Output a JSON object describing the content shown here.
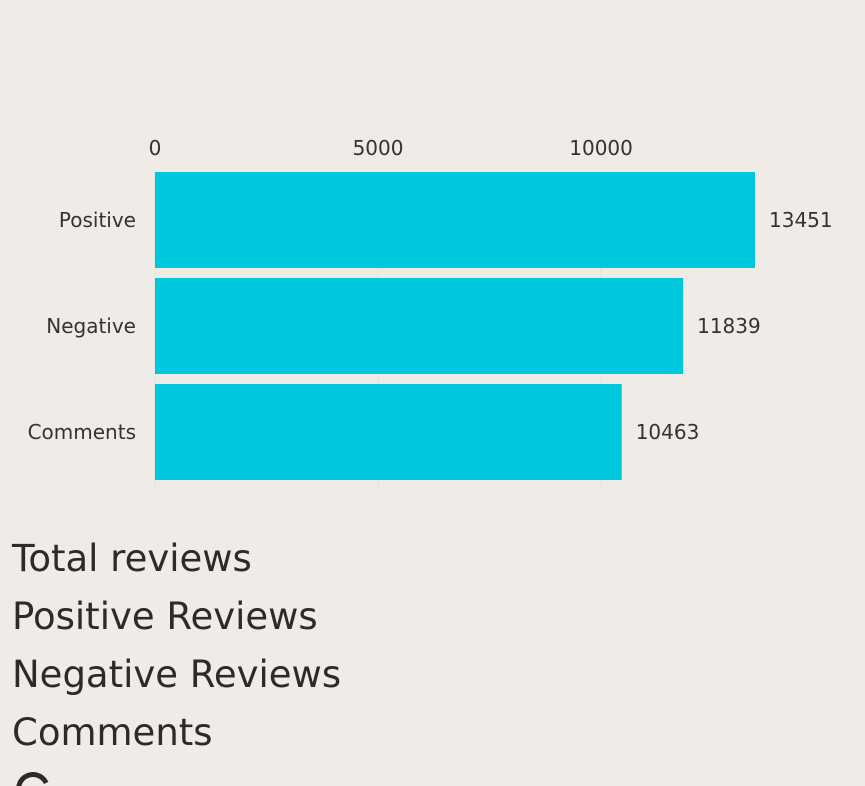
{
  "chart_data": {
    "type": "bar",
    "orientation": "horizontal",
    "categories": [
      "Positive",
      "Negative",
      "Comments"
    ],
    "values": [
      13451,
      11839,
      10463
    ],
    "xlim": [
      0,
      13451
    ],
    "x_ticks": [
      0,
      5000,
      10000
    ],
    "x_tick_labels": [
      "0",
      "5000",
      "10000"
    ],
    "axis_position": "top",
    "grid": true,
    "data_labels": [
      "13451",
      "11839",
      "10463"
    ],
    "bar_color": "#00c8dc",
    "title": "",
    "xlabel": "",
    "ylabel": ""
  },
  "summary": {
    "items": [
      "Total reviews",
      "Positive Reviews",
      "Negative Reviews",
      "Comments"
    ]
  },
  "colors": {
    "background": "#efebe6",
    "bar": "#00c8dc",
    "text": "#2b2b2b",
    "grid": "#e4e0da"
  }
}
